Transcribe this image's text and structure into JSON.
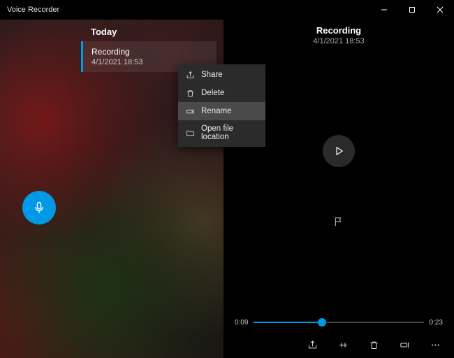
{
  "window": {
    "title": "Voice Recorder"
  },
  "sidebar": {
    "section_label": "Today",
    "recordings": [
      {
        "title": "Recording",
        "subtitle": "4/1/2021 18:53"
      }
    ]
  },
  "context_menu": {
    "items": [
      {
        "label": "Share",
        "icon": "share-icon"
      },
      {
        "label": "Delete",
        "icon": "trash-icon"
      },
      {
        "label": "Rename",
        "icon": "rename-icon",
        "highlighted": true
      },
      {
        "label": "Open file location",
        "icon": "folder-icon"
      }
    ]
  },
  "detail": {
    "title": "Recording",
    "subtitle": "4/1/2021 18:53",
    "current_time": "0:09",
    "total_time": "0:23",
    "progress_pct": 40
  },
  "bottom_actions": {
    "share": "Share",
    "trim": "Trim",
    "delete": "Delete",
    "rename": "Rename",
    "more": "More"
  },
  "colors": {
    "accent": "#0099e5"
  }
}
